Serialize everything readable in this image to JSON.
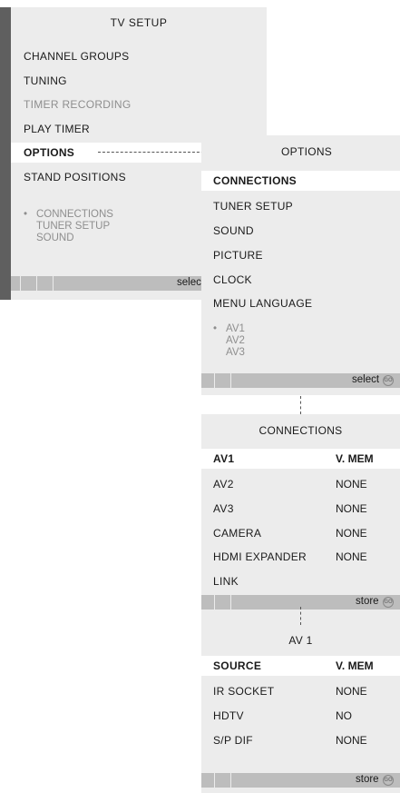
{
  "tv_setup": {
    "title": "TV SETUP",
    "items": [
      {
        "label": "CHANNEL GROUPS"
      },
      {
        "label": "TUNING"
      },
      {
        "label": "TIMER RECORDING"
      },
      {
        "label": "PLAY TIMER"
      },
      {
        "label": "OPTIONS"
      },
      {
        "label": "STAND POSITIONS"
      }
    ],
    "sub_items": [
      "CONNECTIONS",
      "TUNER SETUP",
      "SOUND"
    ],
    "footer_label": "select",
    "go_label": "GO"
  },
  "options": {
    "title": "OPTIONS",
    "items": [
      {
        "label": "CONNECTIONS"
      },
      {
        "label": "TUNER SETUP"
      },
      {
        "label": "SOUND"
      },
      {
        "label": "PICTURE"
      },
      {
        "label": "CLOCK"
      },
      {
        "label": "MENU LANGUAGE"
      }
    ],
    "sub_items": [
      "AV1",
      "AV2",
      "AV3"
    ],
    "footer_label": "select",
    "go_label": "GO"
  },
  "connections": {
    "title": "CONNECTIONS",
    "rows": [
      {
        "label": "AV1",
        "value": "V. MEM"
      },
      {
        "label": "AV2",
        "value": "NONE"
      },
      {
        "label": "AV3",
        "value": "NONE"
      },
      {
        "label": "CAMERA",
        "value": "NONE"
      },
      {
        "label": "HDMI EXPANDER",
        "value": "NONE"
      },
      {
        "label": "LINK",
        "value": ""
      }
    ],
    "footer_label": "store",
    "go_label": "GO"
  },
  "av1": {
    "title": "AV 1",
    "rows": [
      {
        "label": "SOURCE",
        "value": "V. MEM"
      },
      {
        "label": "IR SOCKET",
        "value": "NONE"
      },
      {
        "label": "HDTV",
        "value": "NO"
      },
      {
        "label": "S/P DIF",
        "value": "NONE"
      }
    ],
    "footer_label": "store",
    "go_label": "GO"
  }
}
